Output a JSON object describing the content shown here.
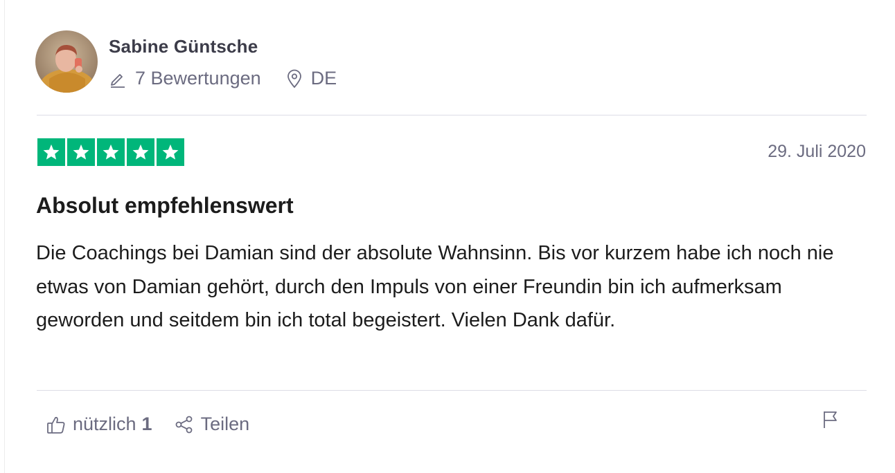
{
  "consumer": {
    "name": "Sabine Güntsche",
    "reviews_count": "7 Bewertungen",
    "country": "DE",
    "avatar_icon": "user-avatar-photo"
  },
  "review": {
    "rating": 5,
    "max_rating": 5,
    "star_color": "#00b67a",
    "date": "29. Juli 2020",
    "title": "Absolut empfehlenswert",
    "text": "Die Coachings bei Damian sind der absolute Wahnsinn. Bis vor kurzem habe ich noch nie etwas von Damian gehört, durch den Impuls von einer Freundin bin ich aufmerksam geworden und seitdem bin ich total begeistert. Vielen Dank dafür."
  },
  "actions": {
    "useful_label": "nützlich",
    "useful_count": "1",
    "share_label": "Teilen",
    "icons": [
      "thumbs-up-icon",
      "share-icon",
      "flag-icon"
    ]
  }
}
